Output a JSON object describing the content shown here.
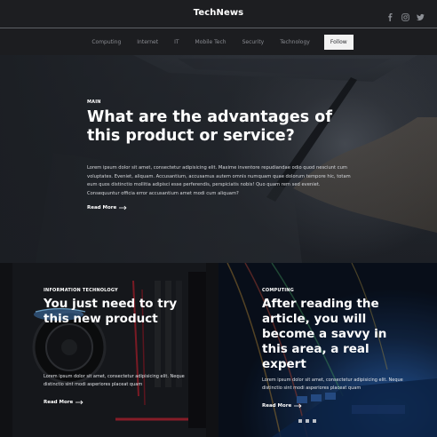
{
  "header": {
    "logo": "TechNews",
    "social_icons": [
      "facebook-icon",
      "instagram-icon",
      "twitter-icon"
    ]
  },
  "nav": {
    "items": [
      "Computing",
      "Internet",
      "IT",
      "Mobile Tech",
      "Security",
      "Technology"
    ],
    "follow_label": "Follow"
  },
  "hero": {
    "category": "MAIN",
    "title": "What are the advantages of this product or service?",
    "text": "Lorem ipsum dolor sit amet, consectetur adipisicing elit. Maxime inventore repudiandae odio quod nesciunt cum voluptates. Eveniet, aliquam. Accusantium, accusamus autem omnis numquam quae dolorum tempore hic, totam eum quos distinctio mollitia adipisci esse perferendis, perspiciatis nobis! Quo quam rem sed eveniet. Consequuntur officia error accusantium amet modi cum aliquam?",
    "read_more": "Read More"
  },
  "cards": [
    {
      "category": "INFORMATION TECHNOLOGY",
      "title": "You just need to try this new product",
      "text": "Lorem ipsum dolor sit amet, consectetur adipisicing elit. Neque distinctio sint modi asperiores placeat quam",
      "read_more": "Read More"
    },
    {
      "category": "COMPUTING",
      "title": "After reading the article, you will become a savvy in this area, a real expert",
      "text": "Lorem ipsum dolor sit amet, consectetur adipisicing elit. Neque distinctio sint modi asperiores placeat quam",
      "read_more": "Read More"
    }
  ],
  "colors": {
    "header_bg": "#1d1e21",
    "nav_text": "#8a8c92",
    "follow_bg": "#f2f2f2"
  }
}
